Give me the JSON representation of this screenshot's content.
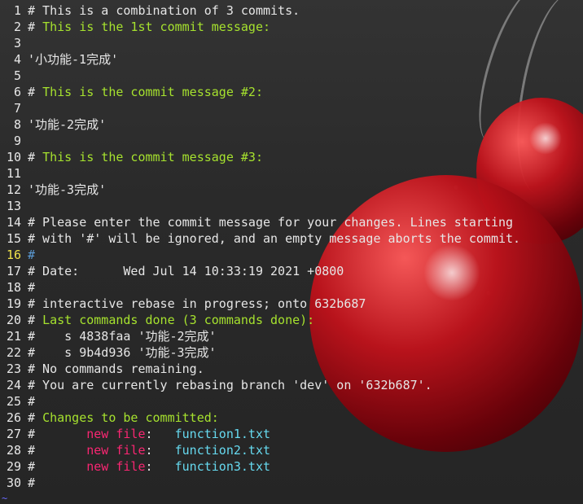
{
  "editor": {
    "lines": [
      {
        "num": "1",
        "segments": [
          {
            "text": "# This is a combination of 3 commits.",
            "color": "default"
          }
        ]
      },
      {
        "num": "2",
        "segments": [
          {
            "text": "# ",
            "color": "default"
          },
          {
            "text": "This is the 1st commit message:",
            "color": "green"
          }
        ]
      },
      {
        "num": "3",
        "segments": []
      },
      {
        "num": "4",
        "segments": [
          {
            "text": "'小功能-1完成'",
            "color": "default"
          }
        ]
      },
      {
        "num": "5",
        "segments": []
      },
      {
        "num": "6",
        "segments": [
          {
            "text": "# ",
            "color": "default"
          },
          {
            "text": "This is the commit message #2:",
            "color": "green"
          }
        ]
      },
      {
        "num": "7",
        "segments": []
      },
      {
        "num": "8",
        "segments": [
          {
            "text": "'功能-2完成'",
            "color": "default"
          }
        ]
      },
      {
        "num": "9",
        "segments": []
      },
      {
        "num": "10",
        "segments": [
          {
            "text": "# ",
            "color": "default"
          },
          {
            "text": "This is the commit message #3:",
            "color": "green"
          }
        ]
      },
      {
        "num": "11",
        "segments": []
      },
      {
        "num": "12",
        "segments": [
          {
            "text": "'功能-3完成'",
            "color": "default"
          }
        ]
      },
      {
        "num": "13",
        "segments": []
      },
      {
        "num": "14",
        "segments": [
          {
            "text": "# Please enter the commit message for your changes. Lines starting",
            "color": "default"
          }
        ]
      },
      {
        "num": "15",
        "segments": [
          {
            "text": "# with '#' will be ignored, and an empty message aborts the commit.",
            "color": "default"
          }
        ]
      },
      {
        "num": "16",
        "current": true,
        "segments": [
          {
            "text": "#",
            "color": "cursor"
          }
        ]
      },
      {
        "num": "17",
        "segments": [
          {
            "text": "# Date:      Wed Jul 14 10:33:19 2021 +0800",
            "color": "default"
          }
        ]
      },
      {
        "num": "18",
        "segments": [
          {
            "text": "#",
            "color": "default"
          }
        ]
      },
      {
        "num": "19",
        "segments": [
          {
            "text": "# interactive rebase in progress; onto 632b687",
            "color": "default"
          }
        ]
      },
      {
        "num": "20",
        "segments": [
          {
            "text": "# ",
            "color": "default"
          },
          {
            "text": "Last commands done (3 commands done):",
            "color": "green"
          }
        ]
      },
      {
        "num": "21",
        "segments": [
          {
            "text": "#    s 4838faa '功能-2完成'",
            "color": "default"
          }
        ]
      },
      {
        "num": "22",
        "segments": [
          {
            "text": "#    s 9b4d936 '功能-3完成'",
            "color": "default"
          }
        ]
      },
      {
        "num": "23",
        "segments": [
          {
            "text": "# No commands remaining.",
            "color": "default"
          }
        ]
      },
      {
        "num": "24",
        "segments": [
          {
            "text": "# You are currently rebasing branch 'dev' on '632b687'.",
            "color": "default"
          }
        ]
      },
      {
        "num": "25",
        "segments": [
          {
            "text": "#",
            "color": "default"
          }
        ]
      },
      {
        "num": "26",
        "segments": [
          {
            "text": "# ",
            "color": "default"
          },
          {
            "text": "Changes to be committed:",
            "color": "green"
          }
        ]
      },
      {
        "num": "27",
        "segments": [
          {
            "text": "#       ",
            "color": "default"
          },
          {
            "text": "new file",
            "color": "red"
          },
          {
            "text": ":   ",
            "color": "default"
          },
          {
            "text": "function1.txt",
            "color": "blue"
          }
        ]
      },
      {
        "num": "28",
        "segments": [
          {
            "text": "#       ",
            "color": "default"
          },
          {
            "text": "new file",
            "color": "red"
          },
          {
            "text": ":   ",
            "color": "default"
          },
          {
            "text": "function2.txt",
            "color": "blue"
          }
        ]
      },
      {
        "num": "29",
        "segments": [
          {
            "text": "#       ",
            "color": "default"
          },
          {
            "text": "new file",
            "color": "red"
          },
          {
            "text": ":   ",
            "color": "default"
          },
          {
            "text": "function3.txt",
            "color": "blue"
          }
        ]
      },
      {
        "num": "30",
        "segments": [
          {
            "text": "#",
            "color": "default"
          }
        ]
      }
    ],
    "end_marker": "~"
  },
  "colors": {
    "default": "#e6e6e6",
    "green": "#a6e22e",
    "red": "#f92672",
    "blue": "#66d9ef",
    "cursor": "#5b9bd5",
    "current_line_number": "#f0e24a"
  }
}
